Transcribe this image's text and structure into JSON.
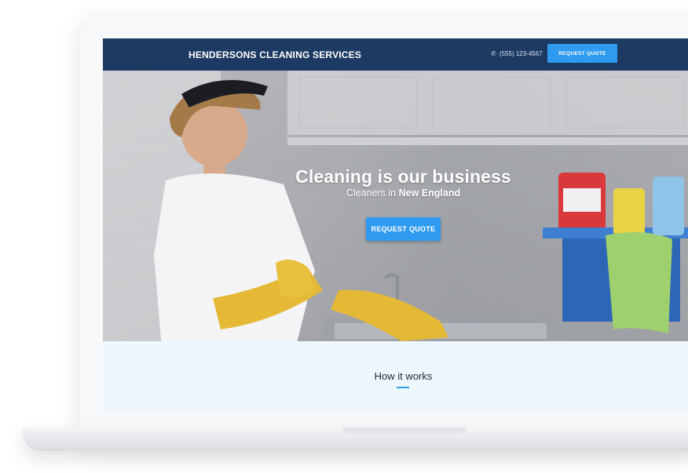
{
  "header": {
    "brand": "HENDERSONS CLEANING SERVICES",
    "phone": "(555) 123-4567",
    "cta_label": "REQUEST QUOTE"
  },
  "hero": {
    "title": "Cleaning is our business",
    "subtitle_prefix": "Cleaners in ",
    "subtitle_bold": "New England",
    "cta_label": "REQUEST QUOTE"
  },
  "how_it_works": {
    "title": "How it works"
  },
  "colors": {
    "header_bg": "#1d3a63",
    "accent": "#2f9bf0",
    "section_bg": "#eef7fe"
  },
  "icons": [
    "phone-icon"
  ]
}
